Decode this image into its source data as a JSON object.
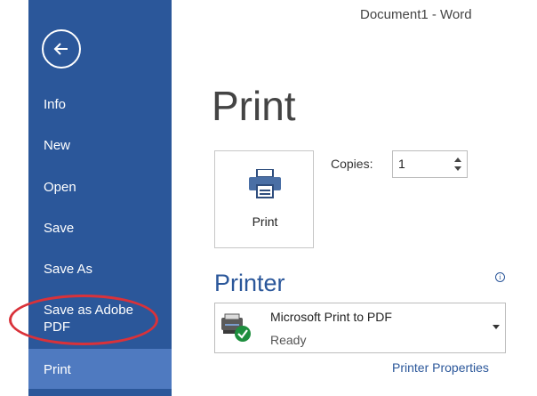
{
  "window": {
    "title": "Document1 - Word"
  },
  "sidebar": {
    "back_icon": "back-arrow-circle-icon",
    "items": [
      {
        "label": "Info"
      },
      {
        "label": "New"
      },
      {
        "label": "Open"
      },
      {
        "label": "Save"
      },
      {
        "label": "Save As"
      },
      {
        "label": "Save as Adobe PDF",
        "highlighted": true
      },
      {
        "label": "Print",
        "active": true
      }
    ]
  },
  "main": {
    "title": "Print",
    "print_button": {
      "label": "Print",
      "icon": "printer-icon"
    },
    "copies": {
      "label": "Copies:",
      "value": "1"
    },
    "printer_section": {
      "title": "Printer",
      "info_icon": "info-icon"
    },
    "printer": {
      "name": "Microsoft Print to PDF",
      "status": "Ready",
      "icon": "printer-ready-icon"
    },
    "printer_properties_link": "Printer Properties"
  },
  "colors": {
    "sidebar": "#2b579a",
    "sidebar_active": "#4f7ac0",
    "accent": "#2b579a",
    "highlight_ellipse": "#d9323a",
    "ready_check": "#1e8e3e"
  }
}
